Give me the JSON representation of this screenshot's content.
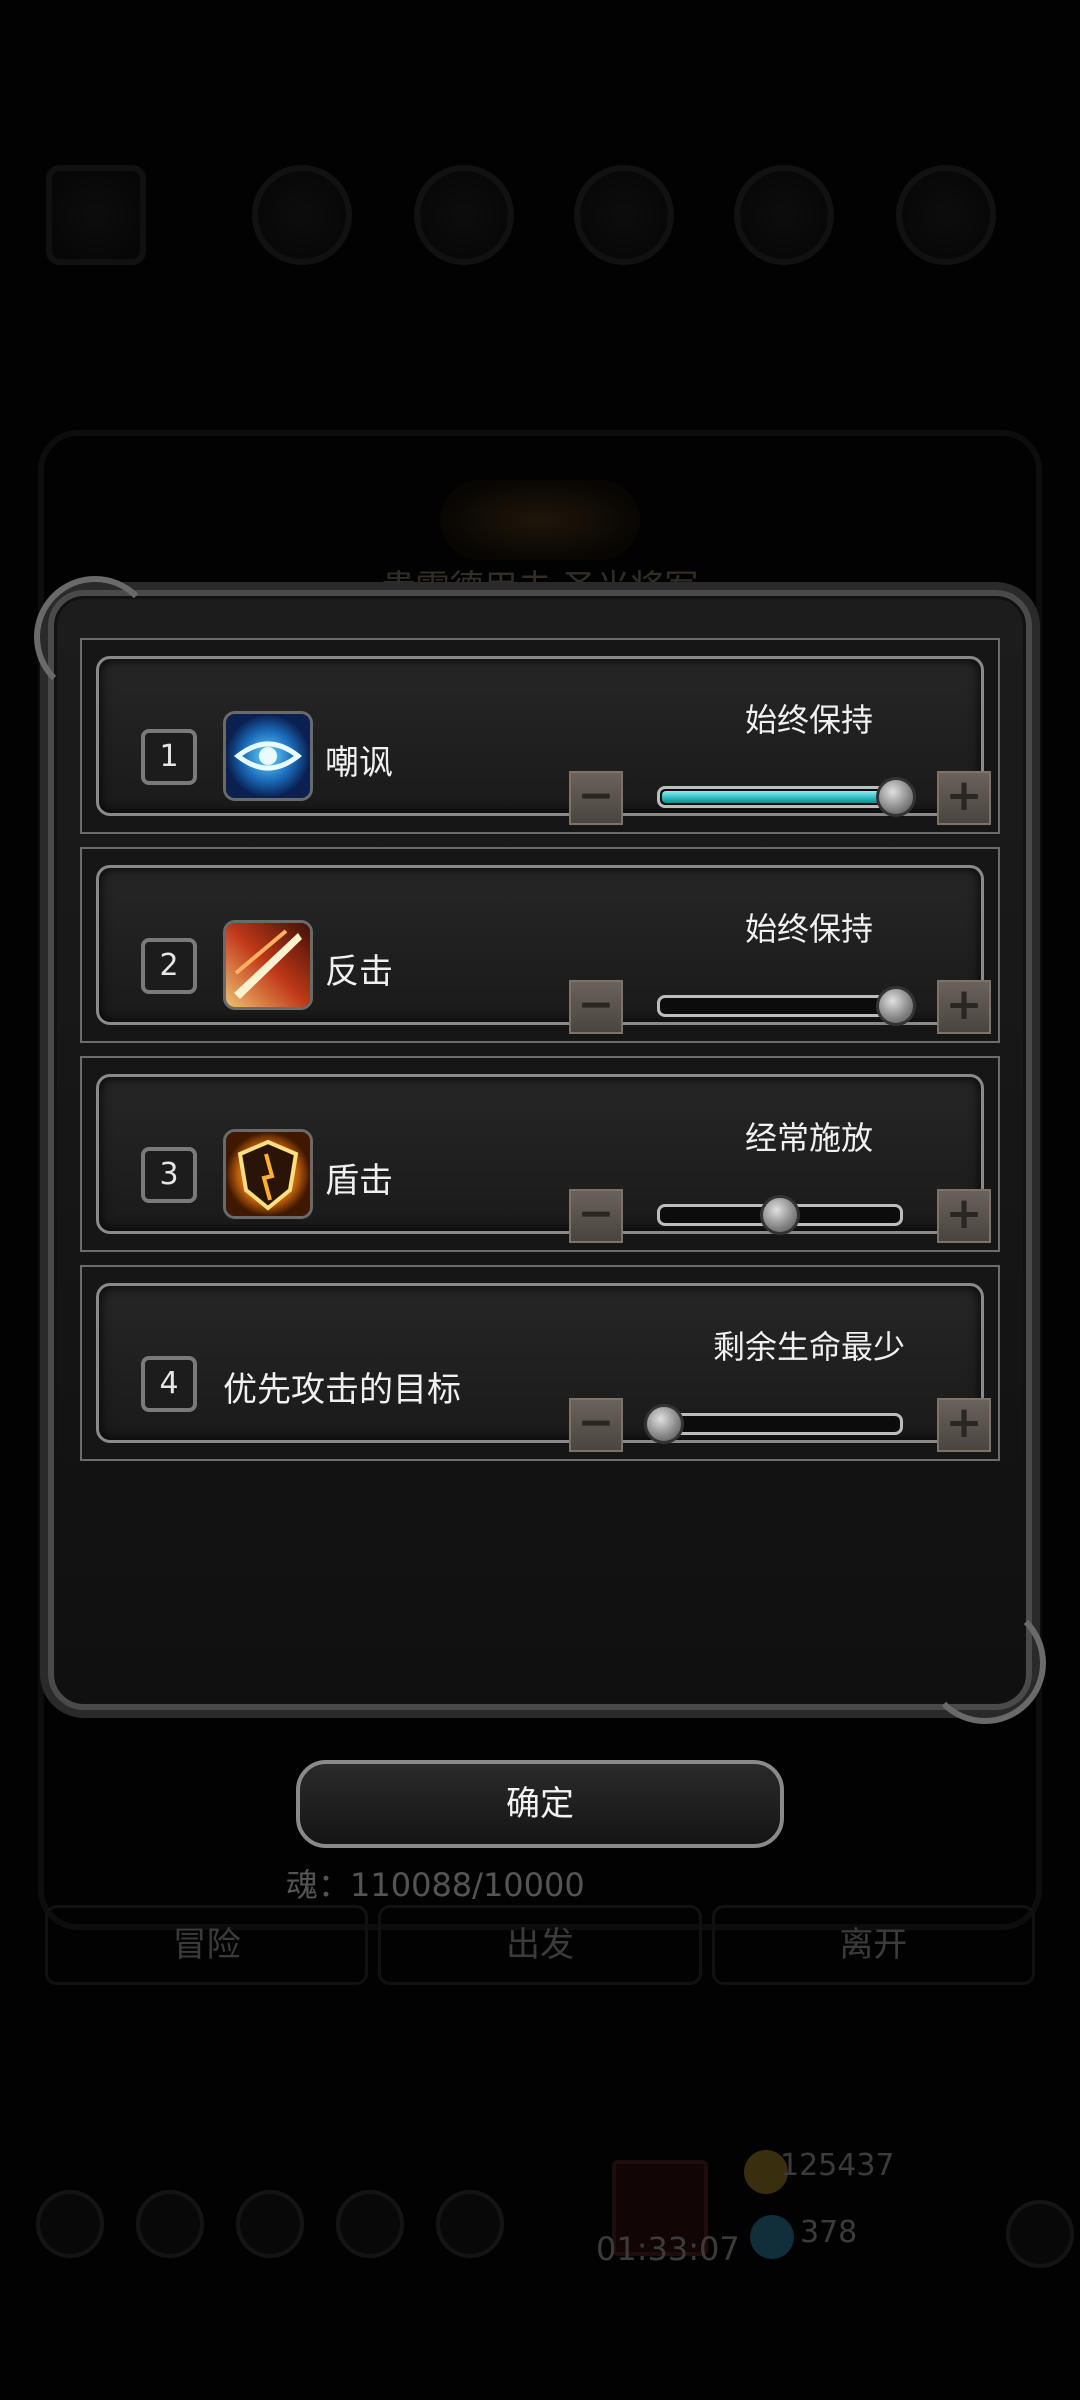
{
  "background": {
    "title": "贵霜德用击 圣光将军",
    "soul_text": "魂：110088/10000",
    "buttons": [
      "冒险",
      "出发",
      "离开"
    ],
    "timer": "01:33:07",
    "currency_gold": "125437",
    "currency_gem": "378"
  },
  "rows": [
    {
      "index": "1",
      "name": "嘲讽",
      "mode": "始终保持",
      "level": 1.0,
      "filled": true,
      "icon": "eye-icon"
    },
    {
      "index": "2",
      "name": "反击",
      "mode": "始终保持",
      "level": 1.0,
      "filled": false,
      "icon": "slash-icon"
    },
    {
      "index": "3",
      "name": "盾击",
      "mode": "经常施放",
      "level": 0.5,
      "filled": false,
      "icon": "shield-icon"
    },
    {
      "index": "4",
      "name": "优先攻击的目标",
      "mode": "剩余生命最少",
      "level": 0.0,
      "filled": false,
      "icon": ""
    }
  ],
  "controls": {
    "minus": "−",
    "plus": "+"
  },
  "confirm_label": "确定",
  "colors": {
    "slider_fill": "#2ab8c0",
    "button": "#5a534c"
  }
}
